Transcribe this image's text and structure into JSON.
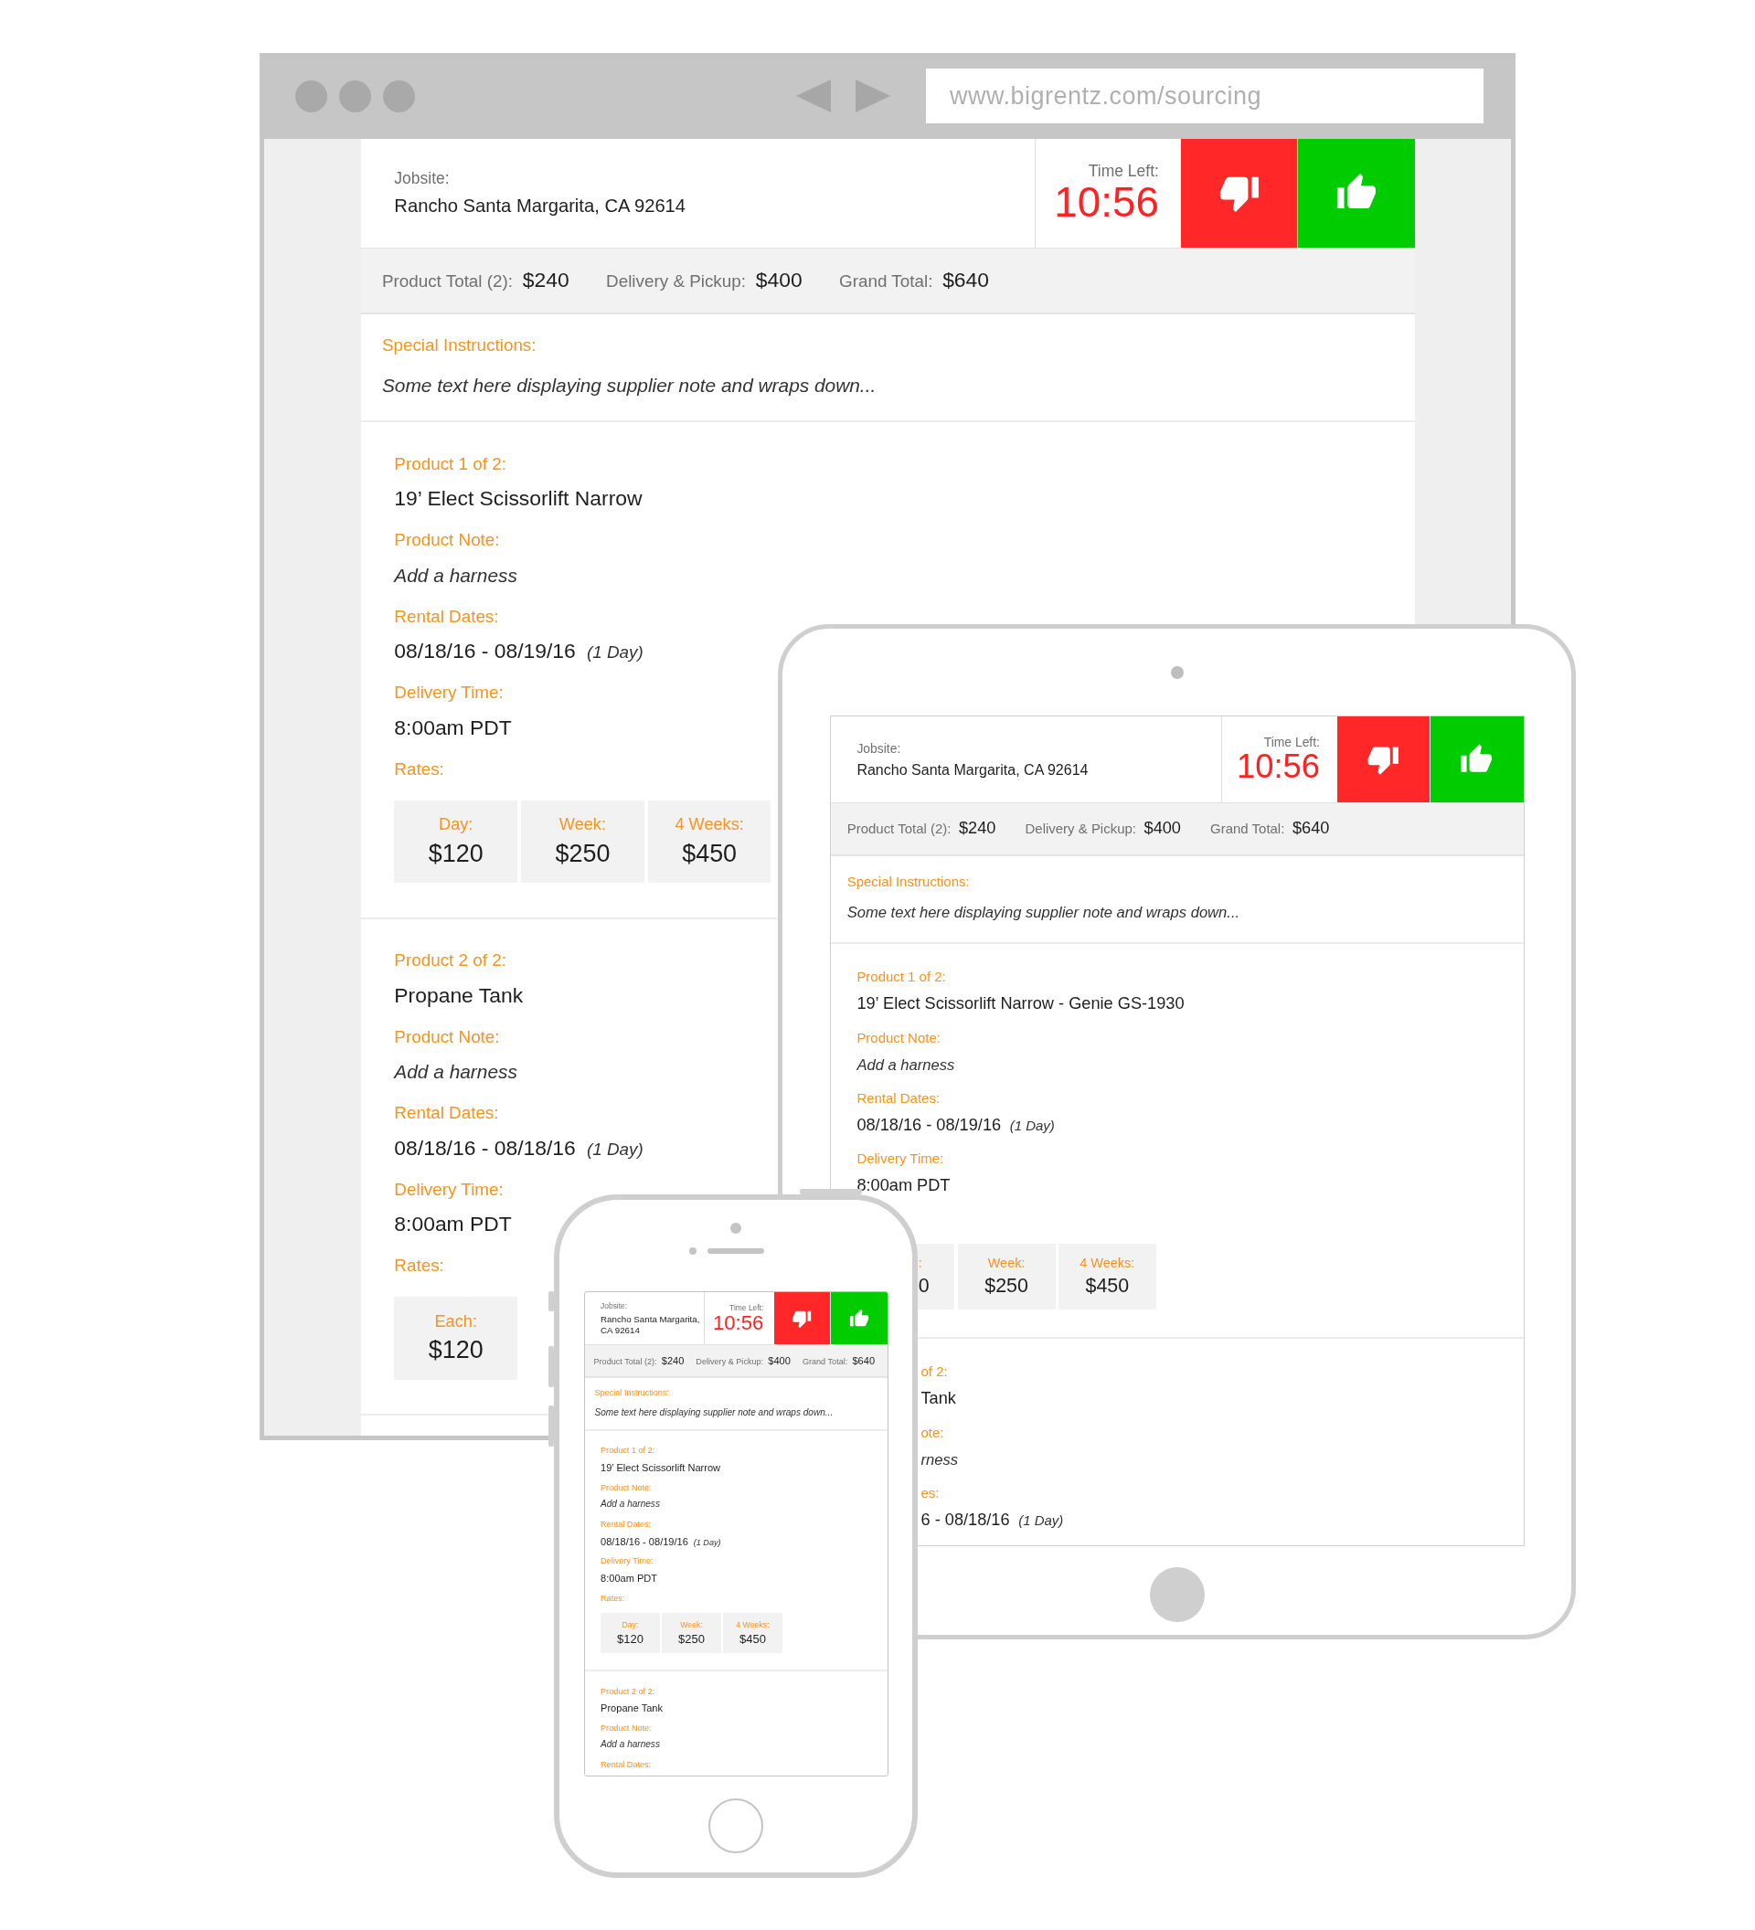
{
  "browser": {
    "url": "www.bigrentz.com/sourcing",
    "screen": {
      "jobsite_label": "Jobsite:",
      "jobsite": "Rancho Santa Margarita, CA 92614",
      "time_left_label": "Time Left:",
      "time_left": "10:56",
      "totals": [
        {
          "label": "Product Total (2):",
          "value": "$240"
        },
        {
          "label": "Delivery & Pickup:",
          "value": "$400"
        },
        {
          "label": "Grand Total:",
          "value": "$640"
        }
      ],
      "special_label": "Special Instructions:",
      "special_text": "Some text here displaying supplier note and wraps down...",
      "products": [
        {
          "kind": "full",
          "heading": "Product 1 of 2:",
          "name": "19’ Elect Scissorlift Narrow",
          "fields": [
            {
              "label": "Product Note:",
              "kind": "note",
              "value": "Add a harness"
            },
            {
              "label": "Rental Dates:",
              "kind": "text",
              "value": "08/18/16 - 08/19/16",
              "extra": "(1 Day)"
            },
            {
              "label": "Delivery Time:",
              "kind": "text",
              "value": "8:00am PDT"
            }
          ],
          "rates_label": "Rates:",
          "rates": [
            {
              "kind": "full",
              "label": "Day:",
              "price": "$120"
            },
            {
              "kind": "full",
              "label": "Week:",
              "price": "$250"
            },
            {
              "kind": "full",
              "label": "4 Weeks:",
              "price": "$450"
            }
          ]
        },
        {
          "kind": "full",
          "heading": "Product 2 of 2:",
          "name": "Propane Tank",
          "fields": [
            {
              "label": "Product Note:",
              "kind": "note",
              "value": "Add a harness"
            },
            {
              "label": "Rental Dates:",
              "kind": "text",
              "value": "08/18/16 - 08/18/16",
              "extra": "(1 Day)"
            },
            {
              "label": "Delivery Time:",
              "kind": "text",
              "value": "8:00am PDT"
            }
          ],
          "rates_label": "Rates:",
          "rates": [
            {
              "kind": "full",
              "label": "Each:",
              "price": "$120"
            }
          ]
        }
      ]
    }
  },
  "tablet": {
    "screen": {
      "jobsite_label": "Jobsite:",
      "jobsite": "Rancho Santa Margarita, CA 92614",
      "time_left_label": "Time Left:",
      "time_left": "10:56",
      "totals": [
        {
          "label": "Product Total (2):",
          "value": "$240"
        },
        {
          "label": "Delivery & Pickup:",
          "value": "$400"
        },
        {
          "label": "Grand Total:",
          "value": "$640"
        }
      ],
      "special_label": "Special Instructions:",
      "special_text": "Some text here displaying supplier note and wraps down...",
      "products": [
        {
          "kind": "full",
          "heading": "Product 1 of 2:",
          "name": "19’ Elect Scissorlift Narrow - Genie GS-1930",
          "fields": [
            {
              "label": "Product Note:",
              "kind": "note",
              "value": "Add a harness"
            },
            {
              "label": "Rental Dates:",
              "kind": "text",
              "value": "08/18/16 - 08/19/16",
              "extra": "(1 Day)"
            },
            {
              "label": "Delivery Time:",
              "kind": "text",
              "value": "8:00am PDT"
            }
          ],
          "rates": [
            {
              "kind": "partial",
              "label": ":",
              "price": "0"
            },
            {
              "kind": "full",
              "label": "Week:",
              "price": "$250"
            },
            {
              "kind": "full",
              "label": "4 Weeks:",
              "price": "$450"
            }
          ]
        },
        {
          "kind": "clipped",
          "heading": "of 2:",
          "name": "Tank",
          "fields": [
            {
              "label": "ote:",
              "kind": "note",
              "value": "rness"
            },
            {
              "label": "es:",
              "kind": "text",
              "value": "6 - 08/18/16",
              "extra": "(1 Day)"
            }
          ]
        }
      ]
    }
  },
  "phone": {
    "screen": {
      "jobsite_label": "Jobsite:",
      "jobsite": "Rancho Santa Margarita, CA 92614",
      "time_left_label": "Time Left:",
      "time_left": "10:56",
      "totals": [
        {
          "label": "Product Total (2):",
          "value": "$240"
        },
        {
          "label": "Delivery & Pickup:",
          "value": "$400"
        },
        {
          "label": "Grand Total:",
          "value": "$640"
        }
      ],
      "special_label": "Special Instructions:",
      "special_text": "Some text here displaying supplier note and wraps down...",
      "products": [
        {
          "kind": "full",
          "heading": "Product 1 of 2:",
          "name": "19’ Elect Scissorlift Narrow",
          "fields": [
            {
              "label": "Product Note:",
              "kind": "note",
              "value": "Add a harness"
            },
            {
              "label": "Rental Dates:",
              "kind": "text",
              "value": "08/18/16 - 08/19/16",
              "extra": "(1 Day)"
            },
            {
              "label": "Delivery Time:",
              "kind": "text",
              "value": "8:00am PDT"
            }
          ],
          "rates_label": "Rates:",
          "rates": [
            {
              "kind": "full",
              "label": "Day:",
              "price": "$120"
            },
            {
              "kind": "full",
              "label": "Week:",
              "price": "$250"
            },
            {
              "kind": "full",
              "label": "4 Weeks:",
              "price": "$450"
            }
          ]
        },
        {
          "kind": "full",
          "heading": "Product 2 of 2:",
          "name": "Propane Tank",
          "fields": [
            {
              "label": "Product Note:",
              "kind": "note",
              "value": "Add a harness"
            },
            {
              "label": "Rental Dates:"
            }
          ]
        }
      ]
    }
  }
}
